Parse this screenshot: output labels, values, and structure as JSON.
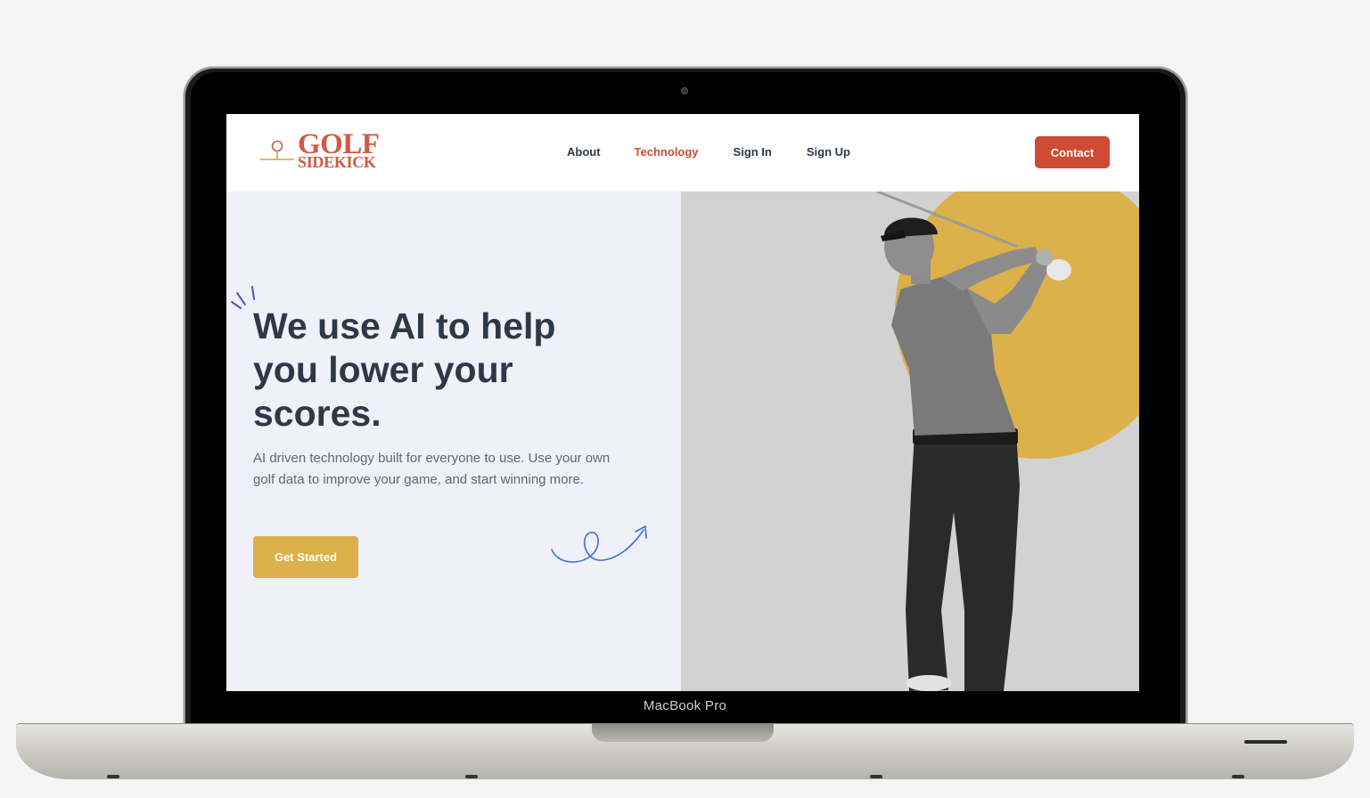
{
  "device": {
    "label": "MacBook Pro"
  },
  "brand": {
    "line1": "GOLF",
    "line2": "SIDEKICK",
    "color": "#d25a44"
  },
  "nav": {
    "items": [
      {
        "label": "About",
        "active": false
      },
      {
        "label": "Technology",
        "active": true
      },
      {
        "label": "Sign In",
        "active": false
      },
      {
        "label": "Sign Up",
        "active": false
      }
    ],
    "contact_label": "Contact"
  },
  "hero": {
    "headline": "We use AI to help you lower your scores.",
    "subtext": "AI driven technology built for everyone to use. Use your own golf data to improve your game, and start winning more.",
    "cta_label": "Get Started"
  },
  "colors": {
    "accent_red": "#cf4b33",
    "accent_gold": "#dcb04a",
    "text_dark": "#2f3848",
    "hero_bg": "#f0f0f8"
  },
  "icons": {
    "logo": "golf-tee-icon",
    "sparkle": "sparkle-lines-icon",
    "swirl": "curly-arrow-icon"
  }
}
